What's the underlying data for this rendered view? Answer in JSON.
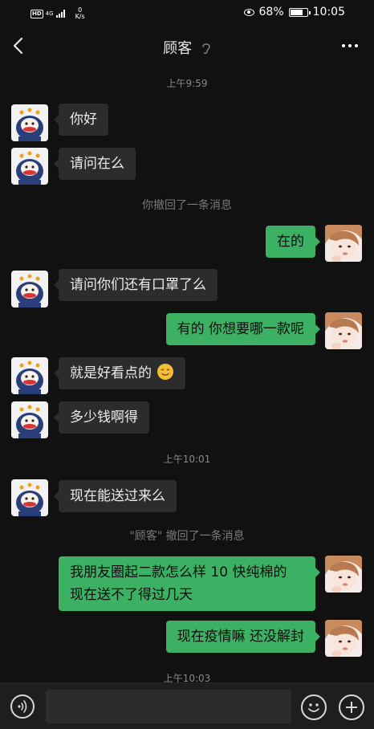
{
  "status_bar": {
    "hd": "HD",
    "network": "4G",
    "speed_value": "0",
    "speed_unit": "K/s",
    "battery": "68%",
    "time": "10:05"
  },
  "nav": {
    "title": "顾客"
  },
  "messages": {
    "t1": "上午9:59",
    "m1": "你好",
    "m2": "请问在么",
    "s1": "你撤回了一条消息",
    "m3": "在的",
    "m4": "请问你们还有口罩了么",
    "m5": "有的 你想要哪一款呢",
    "m6": "就是好看点的",
    "m7": "多少钱啊得",
    "t2": "上午10:01",
    "m8": "现在能送过来么",
    "s2": "\"顾客\" 撤回了一条消息",
    "m9": "我朋友圈起二款怎么样 10 快纯棉的  现在送不了得过几天",
    "m10": "现在疫情嘛 还没解封",
    "t3": "上午10:03"
  },
  "colors": {
    "background": "#111111",
    "incoming_bubble": "#2c2c2c",
    "outgoing_bubble": "#3cb063",
    "input_bar": "#1e1e1e"
  },
  "icons": {
    "back": "chevron-left-icon",
    "ear": "ear-icon",
    "more": "more-dots-icon",
    "voice": "voice-icon",
    "emoji": "smiley-icon",
    "plus": "plus-icon"
  }
}
